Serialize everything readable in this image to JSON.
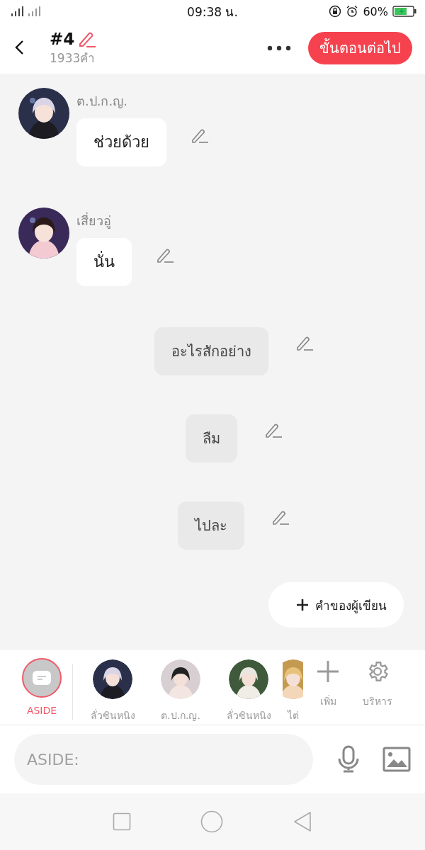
{
  "status_bar": {
    "time": "09:38 น.",
    "battery": "60%"
  },
  "header": {
    "title": "#4",
    "word_count": "1933คำ",
    "next_button": "ขั้นตอนต่อไป"
  },
  "messages": [
    {
      "kind": "character",
      "name": "ต.ป.ก.ญ.",
      "text": "ช่วยด้วย"
    },
    {
      "kind": "character",
      "name": "เสี่ยวอู่",
      "text": "นั่น"
    },
    {
      "kind": "aside",
      "text": "อะไรสักอย่าง"
    },
    {
      "kind": "aside",
      "text": "ลืม"
    },
    {
      "kind": "aside",
      "text": "ไปละ"
    }
  ],
  "author_button": "คำของผู้เขียน",
  "cast": [
    {
      "kind": "aside",
      "label": "ASIDE",
      "selected": true
    },
    {
      "kind": "character",
      "label": "ลั่วซินหนิง",
      "selected": false
    },
    {
      "kind": "character",
      "label": "ต.ป.ก.ญ.",
      "selected": false
    },
    {
      "kind": "character",
      "label": "ลั่วซินหนิง",
      "selected": false
    },
    {
      "kind": "character",
      "label": "ไต่",
      "selected": false
    }
  ],
  "tools": [
    {
      "kind": "add",
      "label": "เพิ่ม"
    },
    {
      "kind": "manage",
      "label": "บริหาร"
    }
  ],
  "composer": {
    "placeholder": "ASIDE:"
  }
}
